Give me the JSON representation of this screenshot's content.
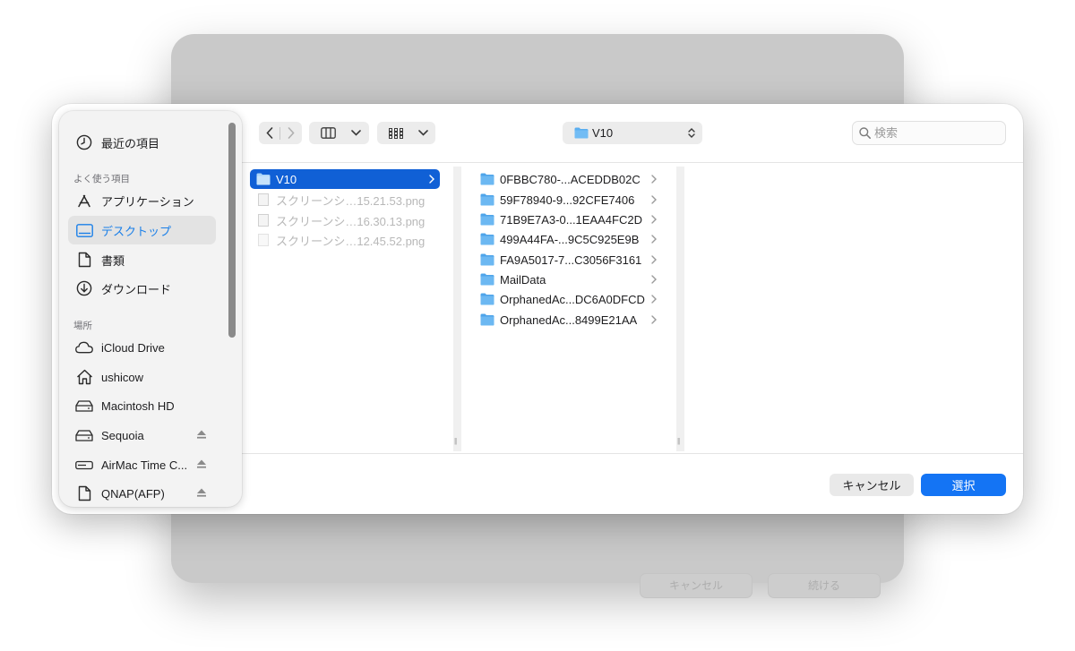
{
  "background_window": {
    "buttons": [
      {
        "label": "キャンセル"
      },
      {
        "label": "続ける"
      }
    ]
  },
  "sidebar": {
    "recent": {
      "label": "最近の項目",
      "icon": "clock-icon"
    },
    "favorites_header": "よく使う項目",
    "favorites": [
      {
        "label": "アプリケーション",
        "icon": "applications-icon"
      },
      {
        "label": "デスクトップ",
        "icon": "desktop-icon",
        "selected": true
      },
      {
        "label": "書類",
        "icon": "document-icon"
      },
      {
        "label": "ダウンロード",
        "icon": "download-icon"
      }
    ],
    "locations_header": "場所",
    "locations": [
      {
        "label": "iCloud Drive",
        "icon": "cloud-icon"
      },
      {
        "label": "ushicow",
        "icon": "home-icon"
      },
      {
        "label": "Macintosh HD",
        "icon": "disk-icon"
      },
      {
        "label": "Sequoia",
        "icon": "disk-icon",
        "eject": true
      },
      {
        "label": "AirMac Time C...",
        "icon": "network-disk-icon",
        "eject": true
      },
      {
        "label": "QNAP(AFP)",
        "icon": "document-icon",
        "eject": true
      }
    ]
  },
  "toolbar": {
    "current_folder": "V10",
    "search_placeholder": "検索"
  },
  "column1": [
    {
      "name": "V10",
      "type": "folder",
      "selected": true
    },
    {
      "name": "スクリーンシ…15.21.53.png",
      "type": "file",
      "disabled": true
    },
    {
      "name": "スクリーンシ…16.30.13.png",
      "type": "file",
      "disabled": true
    },
    {
      "name": "スクリーンシ…12.45.52.png",
      "type": "file",
      "disabled": true
    }
  ],
  "column2": [
    {
      "name": "0FBBC780-...ACEDDB02C"
    },
    {
      "name": "59F78940-9...92CFE7406"
    },
    {
      "name": "71B9E7A3-0...1EAA4FC2D"
    },
    {
      "name": "499A44FA-...9C5C925E9B"
    },
    {
      "name": "FA9A5017-7...C3056F3161"
    },
    {
      "name": "MailData"
    },
    {
      "name": "OrphanedAc...DC6A0DFCD"
    },
    {
      "name": "OrphanedAc...8499E21AA"
    }
  ],
  "buttons": {
    "cancel": "キャンセル",
    "select": "選択"
  },
  "colors": {
    "accent": "#1474f4",
    "selection": "#1060d6",
    "folder": "#5aaef0"
  }
}
